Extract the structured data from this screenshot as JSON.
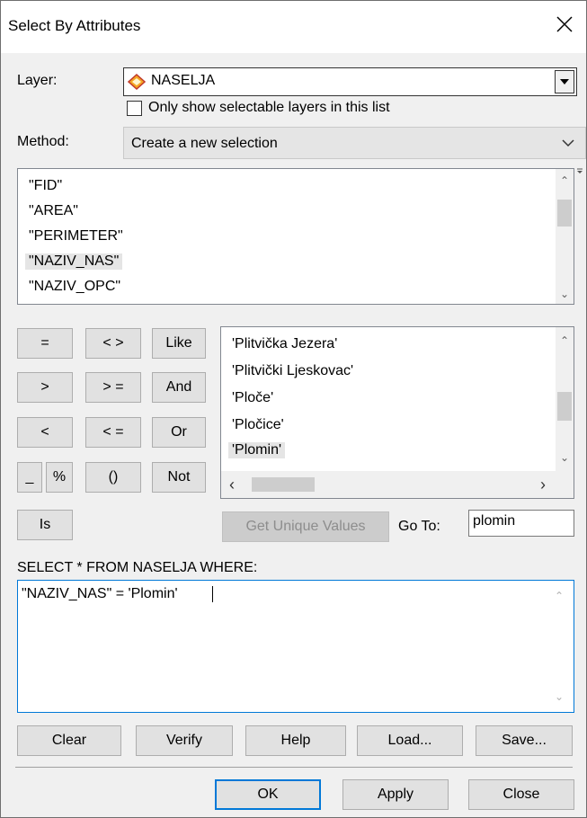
{
  "window": {
    "title": "Select By Attributes"
  },
  "layer": {
    "label": "Layer:",
    "value": "NASELJA",
    "only_selectable_label": "Only show selectable layers in this list"
  },
  "method": {
    "label": "Method:",
    "value": "Create a new selection"
  },
  "fields": [
    "\"FID\"",
    "\"AREA\"",
    "\"PERIMETER\"",
    "\"NAZIV_NAS\"",
    "\"NAZIV_OPC\""
  ],
  "operators": {
    "eq": "=",
    "ne": "< >",
    "like": "Like",
    "gt": ">",
    "ge": "> =",
    "and": "And",
    "lt": "<",
    "le": "< =",
    "or": "Or",
    "underscore": "_",
    "percent": "%",
    "parens": "()",
    "not": "Not",
    "is": "Is"
  },
  "values": [
    "'Plitvička Jezera'",
    "'Plitvički Ljeskovac'",
    "'Ploče'",
    "'Pločice'",
    "'Plomin'"
  ],
  "unique": {
    "button": "Get Unique Values",
    "goto_label": "Go To:",
    "goto_value": "plomin"
  },
  "query": {
    "header": "SELECT * FROM NASELJA WHERE:",
    "expression": "\"NAZIV_NAS\" = 'Plomin'"
  },
  "actions": {
    "clear": "Clear",
    "verify": "Verify",
    "help": "Help",
    "load": "Load...",
    "save": "Save..."
  },
  "footer": {
    "ok": "OK",
    "apply": "Apply",
    "close": "Close"
  },
  "colors": {
    "accent": "#0078d7",
    "selection": "#e5e5e5",
    "layer_icon_fill": "#f5a623",
    "layer_icon_stroke": "#c0392b"
  }
}
